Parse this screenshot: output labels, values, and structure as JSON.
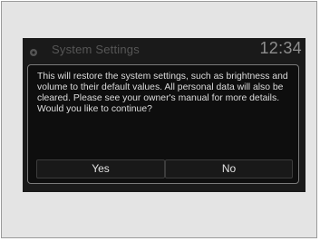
{
  "header": {
    "icon": "settings-icon",
    "title": "System Settings",
    "clock": "12:34"
  },
  "dialog": {
    "message": "This will restore the system settings, such as brightness and volume to their default values. All personal data will also be cleared. Please see your owner's manual for more details. Would you like to continue?",
    "yes_label": "Yes",
    "no_label": "No"
  },
  "colors": {
    "screen_background": "#1a1a1a",
    "dialog_background": "#0e0e0e",
    "text": "#dcdcdc",
    "frame_background": "#e4e4e4"
  }
}
